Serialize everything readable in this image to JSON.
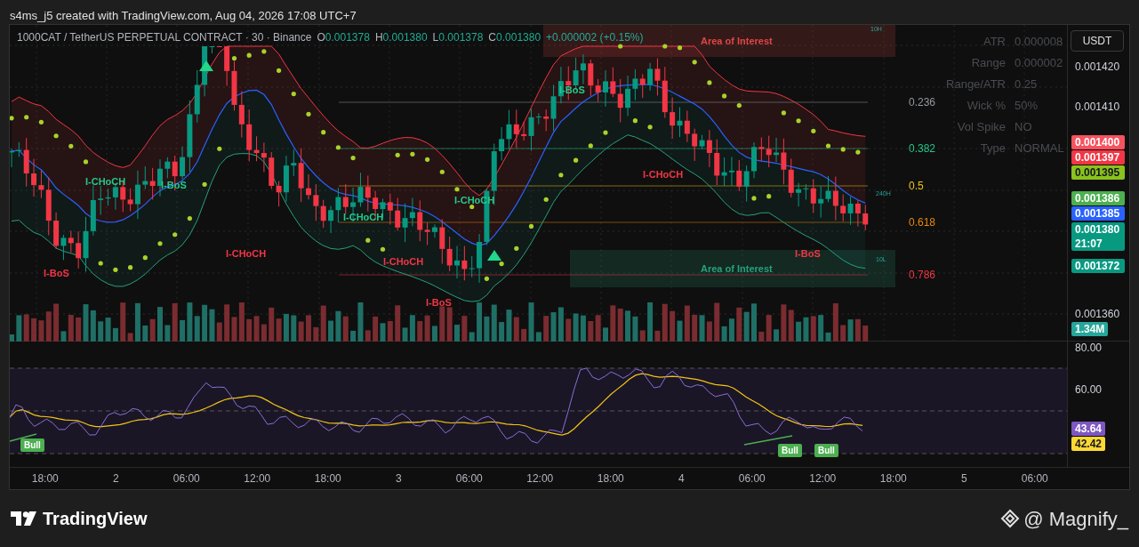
{
  "header": {
    "text": "s4ms_j5 created with TradingView.com, Aug 04, 2026 17:08 UTC+7"
  },
  "legend": {
    "symbol": "1000CAT / TetherUS PERPETUAL CONTRACT · 30 · Binance",
    "ohlc": [
      {
        "key": "O",
        "value": "0.001378"
      },
      {
        "key": "H",
        "value": "0.001380"
      },
      {
        "key": "L",
        "value": "0.001378"
      },
      {
        "key": "C",
        "value": "0.001380"
      }
    ],
    "change": "+0.000002 (+0.15%)"
  },
  "currency_button": "USDT",
  "stats": [
    {
      "label": "ATR",
      "value": "0.000008"
    },
    {
      "label": "Range",
      "value": "0.000002"
    },
    {
      "label": "Range/ATR",
      "value": "0.25"
    },
    {
      "label": "Wick %",
      "value": "50%"
    },
    {
      "label": "Vol Spike",
      "value": "NO"
    },
    {
      "label": "Type",
      "value": "NORMAL"
    }
  ],
  "fib_levels": [
    {
      "label": "0.236",
      "color": "#9598a1"
    },
    {
      "label": "0.382",
      "color": "#22c98a"
    },
    {
      "label": "0.5",
      "color": "#f2c414"
    },
    {
      "label": "0.618",
      "color": "#e8890c"
    },
    {
      "label": "0.786",
      "color": "#f23645"
    }
  ],
  "markers": [
    {
      "label": "I-CHoCH",
      "color": "#26c98a"
    },
    {
      "label": "I-BoS",
      "color": "#26c98a"
    },
    {
      "label": "I-BoS",
      "color": "#f23645"
    },
    {
      "label": "I-CHoCH",
      "color": "#f23645"
    },
    {
      "label": "I-CHoCH",
      "color": "#26c98a"
    },
    {
      "label": "I-CHoCH",
      "color": "#f23645"
    },
    {
      "label": "I-CHoCH",
      "color": "#26c98a"
    },
    {
      "label": "I-BoS",
      "color": "#f23645"
    },
    {
      "label": "I-BoS",
      "color": "#26c98a"
    },
    {
      "label": "I-CHoCH",
      "color": "#f23645"
    },
    {
      "label": "I-BoS",
      "color": "#f23645"
    }
  ],
  "zones": [
    {
      "label": "Area of Interest",
      "color": "#e04646"
    },
    {
      "label": "Area of Interest",
      "color": "#26a17b"
    }
  ],
  "level_tags": [
    "10H",
    "240H",
    "10L"
  ],
  "price_axis": [
    {
      "kind": "tick",
      "label": "0.001420"
    },
    {
      "kind": "tick",
      "label": "0.001410"
    },
    {
      "kind": "tag",
      "label": "0.001400",
      "color": "#f7525f"
    },
    {
      "kind": "tag",
      "label": "0.001397",
      "color": "#f23645"
    },
    {
      "kind": "tag",
      "label": "0.001395",
      "color": "#8bc21b"
    },
    {
      "kind": "tag",
      "label": "0.001386",
      "color": "#4caf50"
    },
    {
      "kind": "tag",
      "label": "0.001385",
      "color": "#2962ff"
    },
    {
      "kind": "tag",
      "label": "0.001380",
      "countdown": "21:07",
      "color": "#089981"
    },
    {
      "kind": "tag",
      "label": "0.001372",
      "color": "#089981"
    },
    {
      "kind": "tick",
      "label": "0.001360"
    },
    {
      "kind": "tag",
      "label": "1.34M",
      "color": "#26a69a"
    }
  ],
  "rsi_axis": [
    {
      "kind": "tick",
      "label": "80.00"
    },
    {
      "kind": "tick",
      "label": "60.00"
    },
    {
      "kind": "tag",
      "label": "43.64",
      "color": "#7e57c2"
    },
    {
      "kind": "tag",
      "label": "42.42",
      "color": "#fdd835"
    }
  ],
  "rsi_signals": [
    "Bull",
    "Bull",
    "Bull"
  ],
  "time_axis": [
    "18:00",
    "2",
    "06:00",
    "12:00",
    "18:00",
    "3",
    "06:00",
    "12:00",
    "18:00",
    "4",
    "06:00",
    "12:00",
    "18:00",
    "5",
    "06:00"
  ],
  "footer": {
    "brand": "TradingView",
    "credit": "@ Magnify_"
  }
}
